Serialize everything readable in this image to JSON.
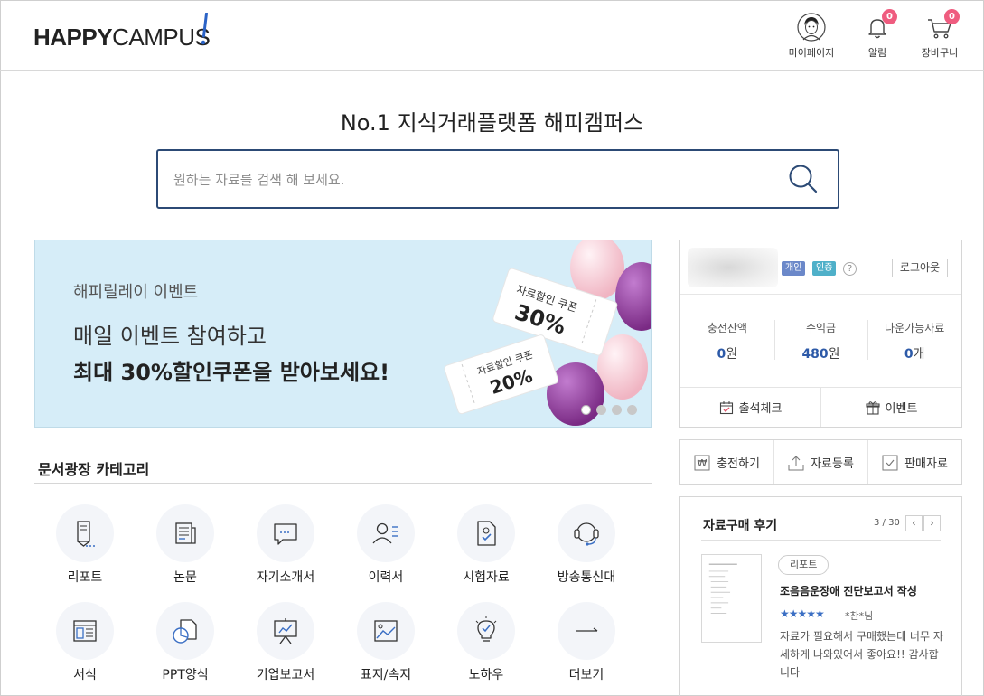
{
  "header": {
    "logo_bold": "HAPPY",
    "logo_light": "CAMPUS",
    "nav": [
      {
        "label": "마이페이지",
        "icon": "user-avatar-icon"
      },
      {
        "label": "알림",
        "icon": "bell-icon",
        "badge": "0"
      },
      {
        "label": "장바구니",
        "icon": "cart-icon",
        "badge": "0"
      }
    ]
  },
  "hero": {
    "title": "No.1 지식거래플랫폼 해피캠퍼스",
    "search_placeholder": "원하는 자료를 검색 해 보세요."
  },
  "banner": {
    "tag": "해피릴레이 이벤트",
    "line1": "매일 이벤트 참여하고",
    "line2": "최대 30%할인쿠폰을 받아보세요!",
    "coupon_big_label": "자료할인 쿠폰",
    "coupon_big_value": "30%",
    "coupon_small_label": "자료할인 쿠폰",
    "coupon_small_value": "20%",
    "active_slide": 1,
    "slide_count": 4
  },
  "category": {
    "title": "문서광장 카테고리",
    "items": [
      {
        "label": "리포트",
        "icon": "report-pen-icon"
      },
      {
        "label": "논문",
        "icon": "thesis-document-icon"
      },
      {
        "label": "자기소개서",
        "icon": "speech-bubble-icon"
      },
      {
        "label": "이력서",
        "icon": "resume-person-icon"
      },
      {
        "label": "시험자료",
        "icon": "exam-check-icon"
      },
      {
        "label": "방송통신대",
        "icon": "headset-icon"
      },
      {
        "label": "서식",
        "icon": "form-layout-icon"
      },
      {
        "label": "PPT양식",
        "icon": "ppt-chart-icon"
      },
      {
        "label": "기업보고서",
        "icon": "presentation-board-icon"
      },
      {
        "label": "표지/속지",
        "icon": "cover-image-icon"
      },
      {
        "label": "노하우",
        "icon": "lightbulb-icon"
      },
      {
        "label": "더보기",
        "icon": "arrow-right-icon"
      }
    ]
  },
  "account": {
    "chip_personal": "개인",
    "chip_verified": "인증",
    "help": "?",
    "logout": "로그아웃",
    "stats": [
      {
        "label": "충전잔액",
        "value": "0",
        "unit": "원"
      },
      {
        "label": "수익금",
        "value": "480",
        "unit": "원"
      },
      {
        "label": "다운가능자료",
        "value": "0",
        "unit": "개"
      }
    ],
    "buttons": [
      {
        "label": "출석체크",
        "icon": "calendar-check-icon"
      },
      {
        "label": "이벤트",
        "icon": "gift-icon"
      }
    ]
  },
  "actions": [
    {
      "label": "충전하기",
      "icon": "won-icon"
    },
    {
      "label": "자료등록",
      "icon": "upload-icon"
    },
    {
      "label": "판매자료",
      "icon": "checkbox-icon"
    }
  ],
  "review": {
    "title": "자료구매 후기",
    "count": "3 / 30",
    "prev": "‹",
    "next": "›",
    "chip": "리포트",
    "doc_title": "조음음운장애 진단보고서 작성",
    "stars": "★★★★★",
    "rating": 5,
    "user": "*찬*님",
    "text": "자료가 필요해서 구매했는데 너무 자세하게 나와있어서 좋아요!! 감사합니다"
  },
  "colors": {
    "accent_navy": "#2c4a75",
    "badge_pink": "#ef5c7f",
    "value_blue": "#2d5aa8",
    "banner_bg": "#d6edf8"
  }
}
